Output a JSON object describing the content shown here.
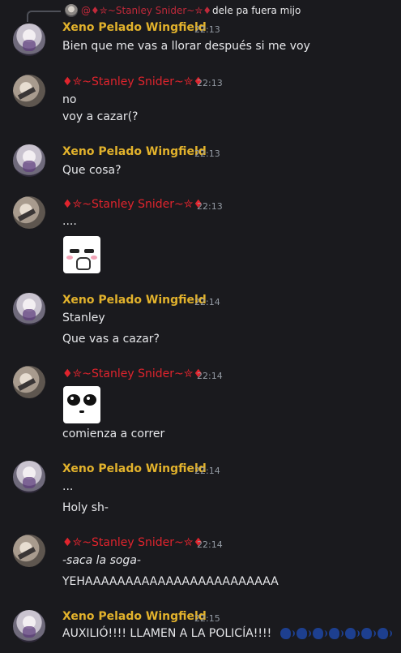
{
  "reply": {
    "author": "@♦✮~Stanley Snider~✮♦",
    "text": "dele pa fuera mijo"
  },
  "messages": [
    {
      "author": "Xeno Pelado Wingfield",
      "time": "22:13",
      "lines": [
        "Bien que me vas a llorar después si me voy"
      ]
    },
    {
      "author": "♦✮~Stanley Snider~✮♦",
      "time": "22:13",
      "lines": [
        "no",
        "voy a cazar(?"
      ]
    },
    {
      "author": "Xeno Pelado Wingfield",
      "time": "22:13",
      "lines": [
        "Que cosa?"
      ]
    },
    {
      "author": "♦✮~Stanley Snider~✮♦",
      "time": "22:13",
      "lines": [
        "...."
      ]
    },
    {
      "author": "Xeno Pelado Wingfield",
      "time": "22:14",
      "lines": [
        "Stanley",
        "Que vas a cazar?"
      ]
    },
    {
      "author": "♦✮~Stanley Snider~✮♦",
      "time": "22:14",
      "lines": [
        "comienza a correr"
      ]
    },
    {
      "author": "Xeno Pelado Wingfield",
      "time": "22:14",
      "lines": [
        "...",
        "Holy sh-"
      ]
    },
    {
      "author": "♦✮~Stanley Snider~✮♦",
      "time": "22:14",
      "lines": [
        "-saca la soga-",
        "YEHAAAAAAAAAAAAAAAAAAAAAAAA"
      ]
    },
    {
      "author": "Xeno Pelado Wingfield",
      "time": "22:15",
      "lines": [
        "AUXILIÓ!!!! LLAMEN A LA POLICÍA!!!!"
      ],
      "emoji": "speaking-head x7"
    }
  ],
  "colors": {
    "background": "#1a1a1e",
    "xeno_name": "#e2b22c",
    "stanley_name": "#e0242d",
    "timestamp": "#949ba4"
  }
}
